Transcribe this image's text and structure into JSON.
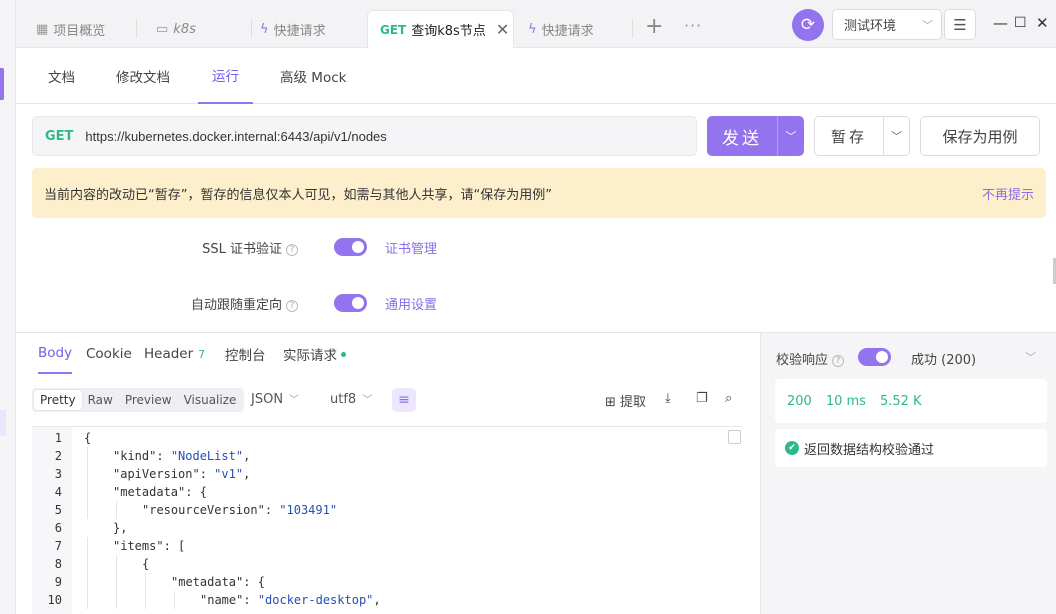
{
  "tabs": [
    {
      "label": "项目概览"
    },
    {
      "label": "k8s"
    },
    {
      "label": "快捷请求"
    },
    {
      "method": "GET",
      "label": "查询k8s节点"
    },
    {
      "label": "快捷请求"
    }
  ],
  "env": {
    "selected": "测试环境"
  },
  "subtabs": [
    "文档",
    "修改文档",
    "运行",
    "高级 Mock"
  ],
  "request": {
    "method": "GET",
    "url": "https://kubernetes.docker.internal:6443/api/v1/nodes",
    "send_label": "发送",
    "stash_label": "暂存",
    "save_case_label": "保存为用例"
  },
  "notice": {
    "text": "当前内容的改动已“暂存”，暂存的信息仅本人可见，如需与其他人共享，请“保存为用例”",
    "dismiss": "不再提示"
  },
  "settings": [
    {
      "label": "SSL 证书验证",
      "link": "证书管理",
      "enabled": true
    },
    {
      "label": "自动跟随重定向",
      "link": "通用设置",
      "enabled": true
    }
  ],
  "response_tabs": [
    {
      "label": "Body"
    },
    {
      "label": "Cookie"
    },
    {
      "label": "Header",
      "count": "7"
    },
    {
      "label": "控制台"
    },
    {
      "label": "实际请求"
    }
  ],
  "format_modes": [
    "Pretty",
    "Raw",
    "Preview",
    "Visualize"
  ],
  "format": {
    "lang": "JSON",
    "encoding": "utf8"
  },
  "tools": {
    "extract": "提取"
  },
  "code_lines": [
    {
      "n": "1",
      "indent": 0,
      "parts": [
        {
          "t": "{",
          "c": "k"
        }
      ]
    },
    {
      "n": "2",
      "indent": 1,
      "parts": [
        {
          "t": "\"kind\"",
          "c": "k"
        },
        {
          "t": ": ",
          "c": "k"
        },
        {
          "t": "\"NodeList\"",
          "c": "s"
        },
        {
          "t": ",",
          "c": "k"
        }
      ]
    },
    {
      "n": "3",
      "indent": 1,
      "parts": [
        {
          "t": "\"apiVersion\"",
          "c": "k"
        },
        {
          "t": ": ",
          "c": "k"
        },
        {
          "t": "\"v1\"",
          "c": "s"
        },
        {
          "t": ",",
          "c": "k"
        }
      ]
    },
    {
      "n": "4",
      "indent": 1,
      "parts": [
        {
          "t": "\"metadata\"",
          "c": "k"
        },
        {
          "t": ": {",
          "c": "k"
        }
      ]
    },
    {
      "n": "5",
      "indent": 2,
      "parts": [
        {
          "t": "\"resourceVersion\"",
          "c": "k"
        },
        {
          "t": ": ",
          "c": "k"
        },
        {
          "t": "\"103491\"",
          "c": "s"
        }
      ]
    },
    {
      "n": "6",
      "indent": 1,
      "parts": [
        {
          "t": "},",
          "c": "k"
        }
      ]
    },
    {
      "n": "7",
      "indent": 1,
      "parts": [
        {
          "t": "\"items\"",
          "c": "k"
        },
        {
          "t": ": [",
          "c": "k"
        }
      ]
    },
    {
      "n": "8",
      "indent": 2,
      "parts": [
        {
          "t": "{",
          "c": "k"
        }
      ]
    },
    {
      "n": "9",
      "indent": 3,
      "parts": [
        {
          "t": "\"metadata\"",
          "c": "k"
        },
        {
          "t": ": {",
          "c": "k"
        }
      ]
    },
    {
      "n": "10",
      "indent": 4,
      "parts": [
        {
          "t": "\"name\"",
          "c": "k"
        },
        {
          "t": ": ",
          "c": "k"
        },
        {
          "t": "\"docker-desktop\"",
          "c": "s"
        },
        {
          "t": ",",
          "c": "k"
        }
      ]
    }
  ],
  "validation": {
    "label": "校验响应",
    "enabled": true,
    "status": "成功 (200)",
    "code": "200",
    "time": "10 ms",
    "size": "5.52 K",
    "result": "返回数据结构校验通过"
  }
}
